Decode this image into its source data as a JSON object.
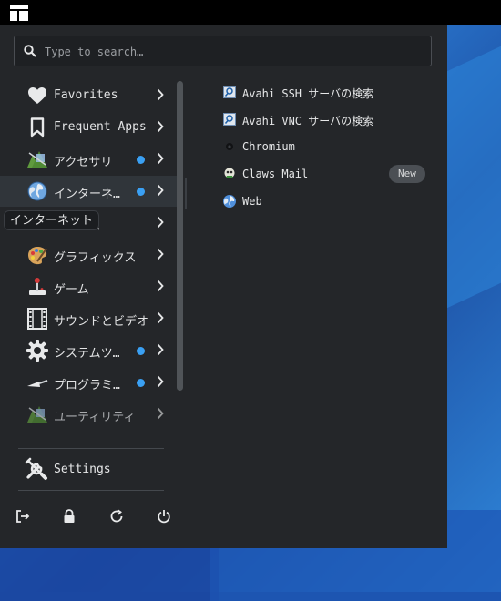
{
  "search": {
    "placeholder": "Type to search…"
  },
  "categories": [
    {
      "label": "Favorites",
      "icon": "heart-icon"
    },
    {
      "label": "Frequent Apps",
      "icon": "bookmark-icon"
    },
    {
      "label": "アクセサリ",
      "icon": "accessories-icon",
      "new": true
    },
    {
      "label": "インターネ…",
      "icon": "internet-globe-icon",
      "new": true,
      "selected": true
    },
    {
      "label": "オフィス",
      "icon": "office-icon"
    },
    {
      "label": "グラフィックス",
      "icon": "graphics-palette-icon"
    },
    {
      "label": "ゲーム",
      "icon": "joystick-icon"
    },
    {
      "label": "サウンドとビデオ",
      "icon": "film-strip-icon"
    },
    {
      "label": "システムツ…",
      "icon": "system-gear-icon",
      "new": true
    },
    {
      "label": "プログラミ…",
      "icon": "programming-trowel-icon",
      "new": true
    },
    {
      "label": "ユーティリティ",
      "icon": "utilities-icon"
    }
  ],
  "tooltip": "インターネット",
  "apps": [
    {
      "label": "Avahi SSH サーバの検索",
      "icon": "avahi-ssh-icon"
    },
    {
      "label": "Avahi VNC サーバの検索",
      "icon": "avahi-vnc-icon"
    },
    {
      "label": "Chromium",
      "icon": "chromium-icon"
    },
    {
      "label": "Claws Mail",
      "icon": "claws-mail-icon",
      "badge": "New"
    },
    {
      "label": "Web",
      "icon": "web-globe-icon"
    }
  ],
  "settings": {
    "label": "Settings"
  },
  "accent_color": "#3aa0f3"
}
